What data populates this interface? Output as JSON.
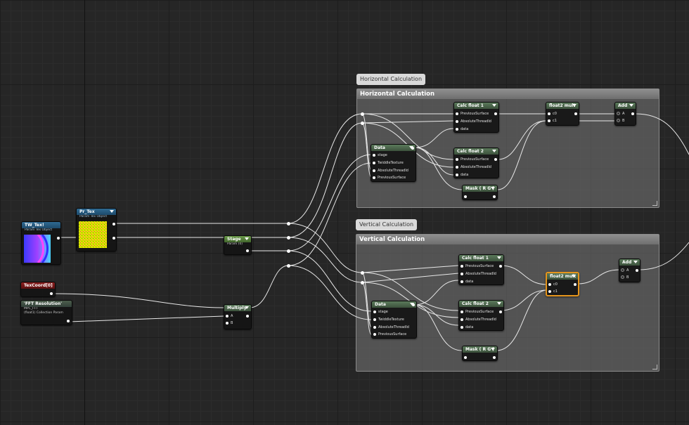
{
  "comments": {
    "horizontal": {
      "bubble": "Horizontal Calculation",
      "header": "Horizontal Calculation"
    },
    "vertical": {
      "bubble": "Vertical Calculation",
      "header": "Vertical Calculation"
    }
  },
  "nodes": {
    "tw_tex": {
      "title": "TW_Tex!",
      "subtitle": "Param Tex Object"
    },
    "pr_tex": {
      "title": "Pr_Tex",
      "subtitle": "Param Tex Object"
    },
    "texcoord": {
      "title": "TexCoord[0]"
    },
    "fft_res": {
      "title": "'FFT Resolution'",
      "sub1": "MPC_FFT",
      "sub2": "(float1) Collection Param"
    },
    "stage": {
      "title": "Stage",
      "subtitle": "Param (0)"
    },
    "multiply": {
      "title": "Multiply",
      "pin_a": "A",
      "pin_b": "B"
    },
    "h_data": {
      "title": "Data",
      "pins": [
        "stage",
        "TwiddleTexture",
        "AbsoluteThreadId",
        "PreviousSurface"
      ]
    },
    "h_calc1": {
      "title": "Calc float 1",
      "pins": [
        "PreviousSurface",
        "AbsoluteThreadId",
        "data"
      ]
    },
    "h_calc2": {
      "title": "Calc float 2",
      "pins": [
        "PreviousSurface",
        "AbsoluteThreadId",
        "data"
      ]
    },
    "h_mask": {
      "title": "Mask ( R G )"
    },
    "h_mult": {
      "title": "float2 mult",
      "pins": [
        "c0",
        "c1"
      ]
    },
    "h_add": {
      "title": "Add",
      "pins": [
        "A",
        "B"
      ]
    },
    "v_data": {
      "title": "Data",
      "pins": [
        "stage",
        "TwiddleTexture",
        "AbsoluteThreadId",
        "PreviousSurface"
      ]
    },
    "v_calc1": {
      "title": "Calc float 1",
      "pins": [
        "PreviousSurface",
        "AbsoluteThreadId",
        "data"
      ]
    },
    "v_calc2": {
      "title": "Calc float 2",
      "pins": [
        "PreviousSurface",
        "AbsoluteThreadId",
        "data"
      ]
    },
    "v_mask": {
      "title": "Mask ( R G )"
    },
    "v_mult": {
      "title": "float2 mult",
      "pins": [
        "c0",
        "c1"
      ]
    },
    "v_add": {
      "title": "Add",
      "pins": [
        "A",
        "B"
      ]
    }
  }
}
